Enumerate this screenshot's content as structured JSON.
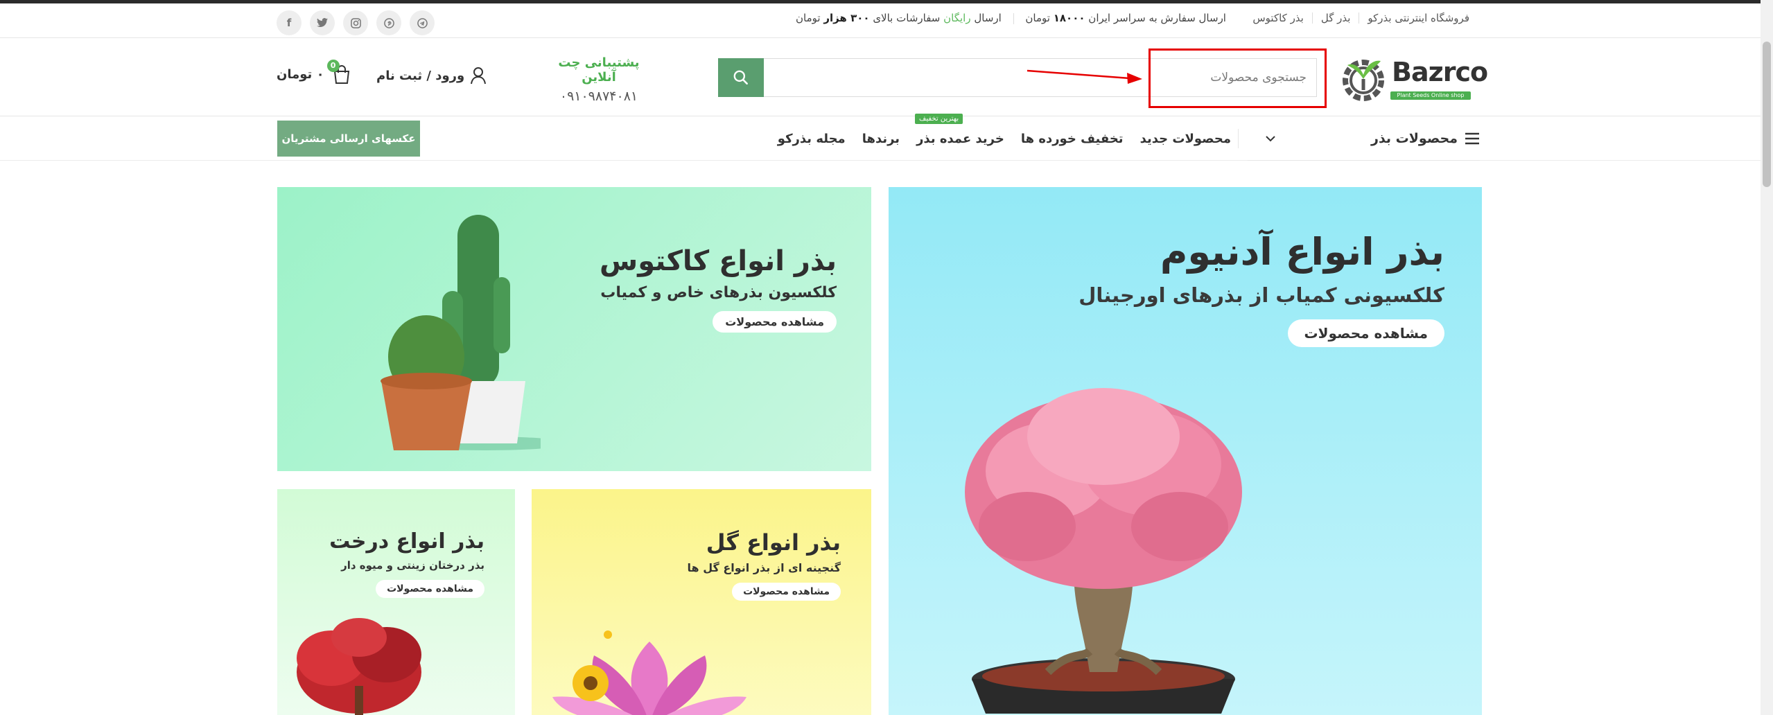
{
  "topbar": {
    "social_icons": [
      "facebook-icon",
      "twitter-icon",
      "instagram-icon",
      "pinterest-icon",
      "telegram-icon"
    ],
    "promo_part1": "ارسال سفارش به سراسر ایران",
    "promo_amount1": "۱۸۰۰۰",
    "promo_unit1": "تومان",
    "promo_part2": "ارسال",
    "promo_free": "رایگان",
    "promo_part3": "سفارشات بالای",
    "promo_amount2": "۳۰۰ هزار",
    "promo_unit2": "تومان",
    "links": [
      "فروشگاه اینترنتی بذرکو",
      "بذر گل",
      "بذر کاکتوس"
    ]
  },
  "header": {
    "logo_text": "Bazrco",
    "logo_tagline": "Plant Seeds Online shop",
    "search_placeholder": "جستجوی محصولات",
    "support_title": "پشتیبانی چت آنلاین",
    "support_phone": "۰۹۱۰۹۸۷۴۰۸۱",
    "login_label": "ورود / ثبت نام",
    "cart_count": "0",
    "cart_total": "۰ تومان"
  },
  "nav": {
    "categories_label": "محصولات بذر",
    "links": [
      "محصولات جدید",
      "تخفیف خورده ها",
      "خرید عمده بذر",
      "برندها",
      "مجله بذرکو"
    ],
    "hot_badge": "بهترین تخفیف",
    "photos_button": "عکسهای ارسالی مشتریان"
  },
  "banners": {
    "adenium": {
      "title": "بذر انواع آدنیوم",
      "subtitle": "کلکسیونی کمیاب از بذرهای اورجینال",
      "button": "مشاهده محصولات"
    },
    "cactus": {
      "title": "بذر انواع کاکتوس",
      "subtitle": "کلکسیون بذرهای خاص و کمیاب",
      "button": "مشاهده محصولات"
    },
    "flower": {
      "title": "بذر انواع گل",
      "subtitle": "گنجینه ای از بذر انواع گل ها",
      "button": "مشاهده محصولات"
    },
    "tree": {
      "title": "بذر انواع درخت",
      "subtitle": "بذر درختان زینتی و میوه دار",
      "button": "مشاهده محصولات"
    }
  },
  "colors": {
    "brand_green": "#5a9e6f",
    "accent_green": "#4caf50",
    "highlight_red": "#e60000"
  }
}
